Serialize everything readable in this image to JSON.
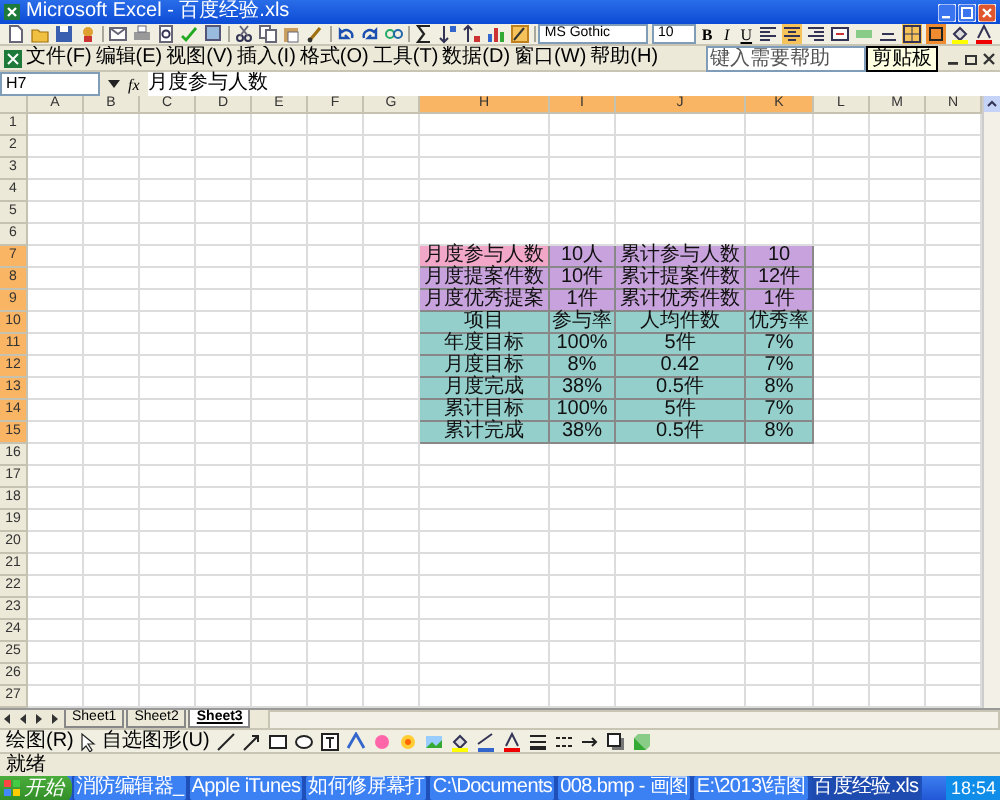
{
  "window": {
    "title": "Microsoft Excel - 百度经验.xls"
  },
  "toolbar": {
    "font": "MS Gothic",
    "font_size": "10",
    "format_buttons": [
      "B",
      "I",
      "U"
    ]
  },
  "tooltip": "剪贴板",
  "menu": [
    "文件(F)",
    "编辑(E)",
    "视图(V)",
    "插入(I)",
    "格式(O)",
    "工具(T)",
    "数据(D)",
    "窗口(W)",
    "帮助(H)"
  ],
  "help_box": {
    "placeholder": "键入需要帮助"
  },
  "formula_bar": {
    "cell": "H7",
    "function_label": "fx",
    "value": "月度参与人数"
  },
  "sheet": {
    "columns": [
      {
        "label": "A",
        "selected": false
      },
      {
        "label": "B",
        "selected": false
      },
      {
        "label": "C",
        "selected": false
      },
      {
        "label": "D",
        "selected": false
      },
      {
        "label": "E",
        "selected": false
      },
      {
        "label": "F",
        "selected": false
      },
      {
        "label": "G",
        "selected": false
      },
      {
        "label": "H",
        "selected": true
      },
      {
        "label": "I",
        "selected": true
      },
      {
        "label": "J",
        "selected": true
      },
      {
        "label": "K",
        "selected": true
      },
      {
        "label": "L",
        "selected": false
      },
      {
        "label": "M",
        "selected": false
      },
      {
        "label": "N",
        "selected": false
      }
    ],
    "rows": [
      {
        "label": "1",
        "selected": false
      },
      {
        "label": "2",
        "selected": false
      },
      {
        "label": "3",
        "selected": false
      },
      {
        "label": "4",
        "selected": false
      },
      {
        "label": "5",
        "selected": false
      },
      {
        "label": "6",
        "selected": false
      },
      {
        "label": "7",
        "selected": true,
        "cells": [
          {
            "text": "月度参与人数",
            "color": "#f2a7c9"
          },
          {
            "text": "10人",
            "color": "#c7a2dc"
          },
          {
            "text": "累计参与人数",
            "color": "#c7a2dc"
          },
          {
            "text": "10",
            "color": "#c7a2dc"
          }
        ]
      },
      {
        "label": "8",
        "selected": true,
        "cells": [
          {
            "text": "月度提案件数",
            "color": "#c7a2dc"
          },
          {
            "text": "10件",
            "color": "#c7a2dc"
          },
          {
            "text": "累计提案件数",
            "color": "#c7a2dc"
          },
          {
            "text": "12件",
            "color": "#c7a2dc"
          }
        ]
      },
      {
        "label": "9",
        "selected": true,
        "cells": [
          {
            "text": "月度优秀提案",
            "color": "#c7a2dc"
          },
          {
            "text": "1件",
            "color": "#c7a2dc"
          },
          {
            "text": "累计优秀件数",
            "color": "#c7a2dc"
          },
          {
            "text": "1件",
            "color": "#c7a2dc"
          }
        ]
      },
      {
        "label": "10",
        "selected": true,
        "cells": [
          {
            "text": "项目",
            "color": "#94cfcc"
          },
          {
            "text": "参与率",
            "color": "#94cfcc"
          },
          {
            "text": "人均件数",
            "color": "#94cfcc"
          },
          {
            "text": "优秀率",
            "color": "#94cfcc"
          }
        ]
      },
      {
        "label": "11",
        "selected": true,
        "cells": [
          {
            "text": "年度目标",
            "color": "#94cfcc"
          },
          {
            "text": "100%",
            "color": "#94cfcc"
          },
          {
            "text": "5件",
            "color": "#94cfcc"
          },
          {
            "text": "7%",
            "color": "#94cfcc"
          }
        ]
      },
      {
        "label": "12",
        "selected": true,
        "cells": [
          {
            "text": "月度目标",
            "color": "#94cfcc"
          },
          {
            "text": "8%",
            "color": "#94cfcc"
          },
          {
            "text": "0.42",
            "color": "#94cfcc"
          },
          {
            "text": "7%",
            "color": "#94cfcc"
          }
        ]
      },
      {
        "label": "13",
        "selected": true,
        "cells": [
          {
            "text": "月度完成",
            "color": "#94cfcc"
          },
          {
            "text": "38%",
            "color": "#94cfcc"
          },
          {
            "text": "0.5件",
            "color": "#94cfcc"
          },
          {
            "text": "8%",
            "color": "#94cfcc"
          }
        ]
      },
      {
        "label": "14",
        "selected": true,
        "cells": [
          {
            "text": "累计目标",
            "color": "#94cfcc"
          },
          {
            "text": "100%",
            "color": "#94cfcc"
          },
          {
            "text": "5件",
            "color": "#94cfcc"
          },
          {
            "text": "7%",
            "color": "#94cfcc"
          }
        ]
      },
      {
        "label": "15",
        "selected": true,
        "cells": [
          {
            "text": "累计完成",
            "color": "#94cfcc"
          },
          {
            "text": "38%",
            "color": "#94cfcc"
          },
          {
            "text": "0.5件",
            "color": "#94cfcc"
          },
          {
            "text": "8%",
            "color": "#94cfcc"
          }
        ]
      },
      {
        "label": "16",
        "selected": false
      },
      {
        "label": "17",
        "selected": false
      },
      {
        "label": "18",
        "selected": false
      },
      {
        "label": "19",
        "selected": false
      },
      {
        "label": "20",
        "selected": false
      },
      {
        "label": "21",
        "selected": false
      },
      {
        "label": "22",
        "selected": false
      },
      {
        "label": "23",
        "selected": false
      },
      {
        "label": "24",
        "selected": false
      },
      {
        "label": "25",
        "selected": false
      },
      {
        "label": "26",
        "selected": false
      },
      {
        "label": "27",
        "selected": false
      }
    ]
  },
  "sheet_tabs": [
    {
      "label": "Sheet1",
      "selected": false
    },
    {
      "label": "Sheet2",
      "selected": false
    },
    {
      "label": "Sheet3",
      "selected": true
    }
  ],
  "drawing_toolbar": {
    "draw_menu": "绘图(R)",
    "autoshapes_menu": "自选图形(U)"
  },
  "status_bar": {
    "status": "就绪"
  },
  "taskbar": {
    "start": "开始",
    "items": [
      {
        "label": "消防编辑器_",
        "selected": false
      },
      {
        "label": "Apple iTunes",
        "selected": false
      },
      {
        "label": "如何修屏幕打",
        "selected": false
      },
      {
        "label": "C:\\Documents",
        "selected": false
      },
      {
        "label": "008.bmp - 画图",
        "selected": false
      },
      {
        "label": "E:\\2013\\结图",
        "selected": false
      },
      {
        "label": "百度经验.xls",
        "selected": true
      }
    ],
    "clock": "18:54"
  }
}
